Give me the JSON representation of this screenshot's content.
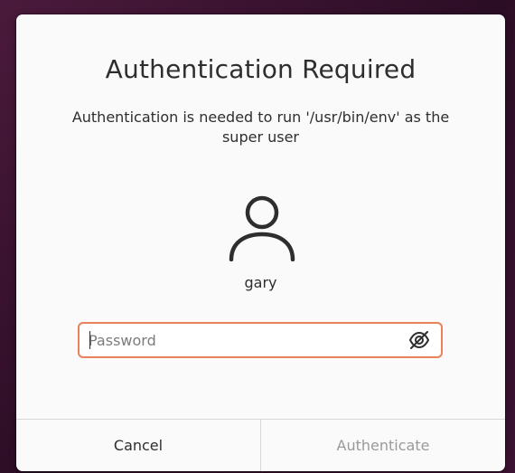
{
  "dialog": {
    "title": "Authentication Required",
    "message": "Authentication is needed to run '/usr/bin/env' as the super user",
    "avatar_icon": "user-icon",
    "username": "gary"
  },
  "password": {
    "placeholder": "Password",
    "value": "",
    "reveal_icon": "eye-slash-icon"
  },
  "buttons": {
    "cancel_label": "Cancel",
    "authenticate_label": "Authenticate",
    "authenticate_enabled": false
  },
  "colors": {
    "focus_border": "#e9815a",
    "dialog_bg": "#fafafa",
    "disabled_text": "#9a9a9a"
  }
}
